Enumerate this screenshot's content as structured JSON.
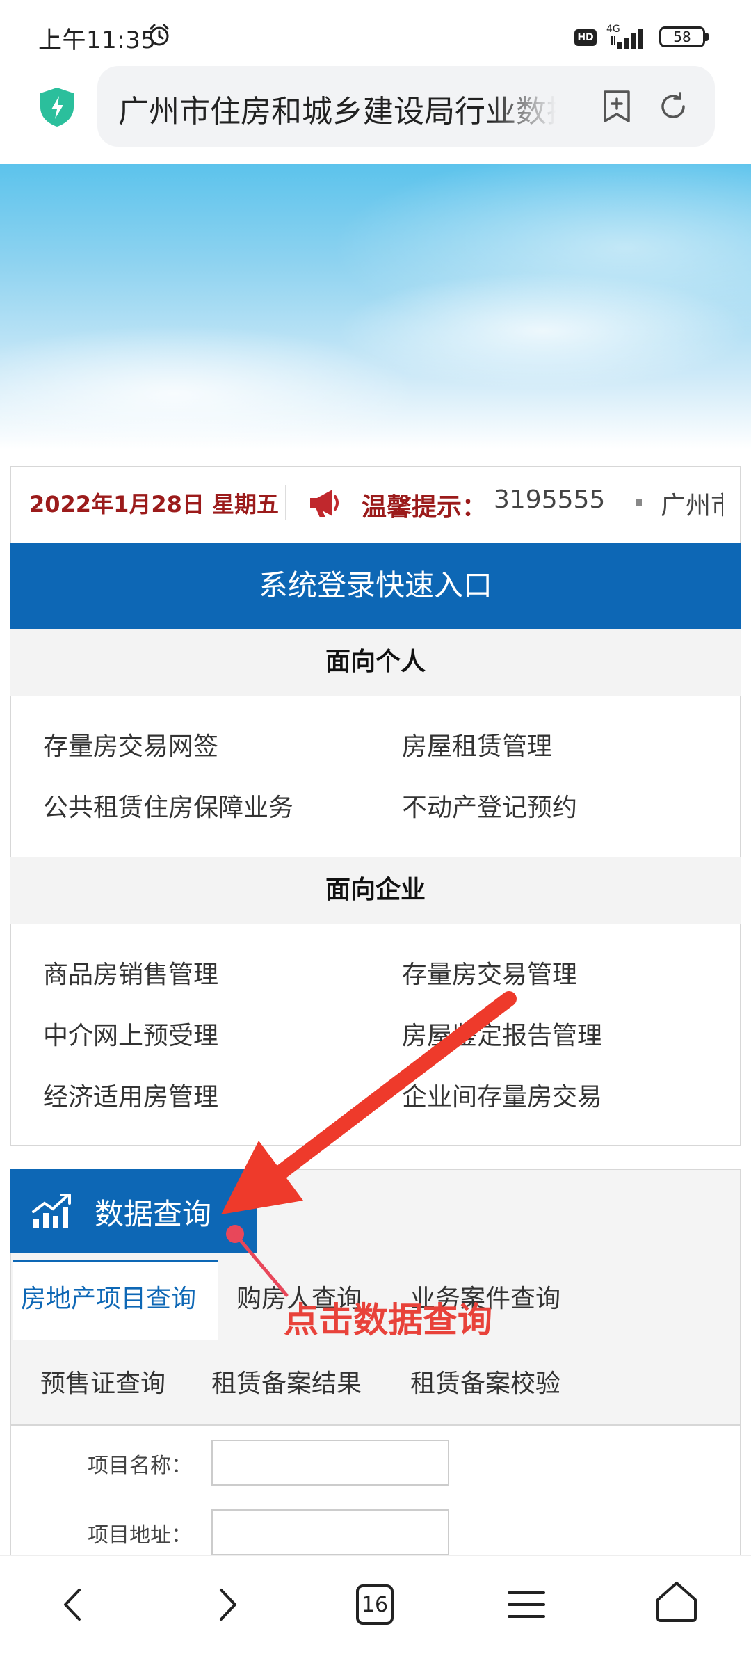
{
  "status": {
    "time": "上午11:35",
    "hd": "HD",
    "network": "4G",
    "battery": "58"
  },
  "browser": {
    "url_title": "广州市住房和城乡建设局行业数据"
  },
  "ticker": {
    "date": "2022年1月28日 星期五",
    "tip_label": "温馨提示：",
    "tip_text": "3195555",
    "tip_text2": "广州市"
  },
  "login": {
    "title": "系统登录快速入口"
  },
  "personal": {
    "heading": "面向个人",
    "links": [
      "存量房交易网签",
      "房屋租赁管理",
      "公共租赁住房保障业务",
      "不动产登记预约"
    ]
  },
  "enterprise": {
    "heading": "面向企业",
    "links": [
      "商品房销售管理",
      "存量房交易管理",
      "中介网上预受理",
      "房屋鉴定报告管理",
      "经济适用房管理",
      "企业间存量房交易"
    ]
  },
  "data_query": {
    "title": "数据查询",
    "tabs": [
      "房地产项目查询",
      "购房人查询",
      "业务案件查询",
      "预售证查询",
      "租赁备案结果",
      "租赁备案校验"
    ],
    "active_tab": "房地产项目查询",
    "fields": [
      {
        "label": "项目名称：",
        "value": ""
      },
      {
        "label": "项目地址：",
        "value": ""
      }
    ]
  },
  "annotation": {
    "text": "点击数据查询",
    "color": "#e8423a"
  },
  "bottom_nav": {
    "tab_count": "16"
  },
  "colors": {
    "primary_blue": "#0d67b5",
    "date_red": "#9b1b1b",
    "annotation_red": "#e8423a",
    "shield_teal": "#2bbf9c"
  },
  "icons": [
    "alarm-icon",
    "signal-icon",
    "shield-icon",
    "add-bookmark-icon",
    "reload-icon",
    "megaphone-icon",
    "chart-growth-icon",
    "back-icon",
    "forward-icon",
    "tabs-icon",
    "menu-icon",
    "home-icon"
  ]
}
